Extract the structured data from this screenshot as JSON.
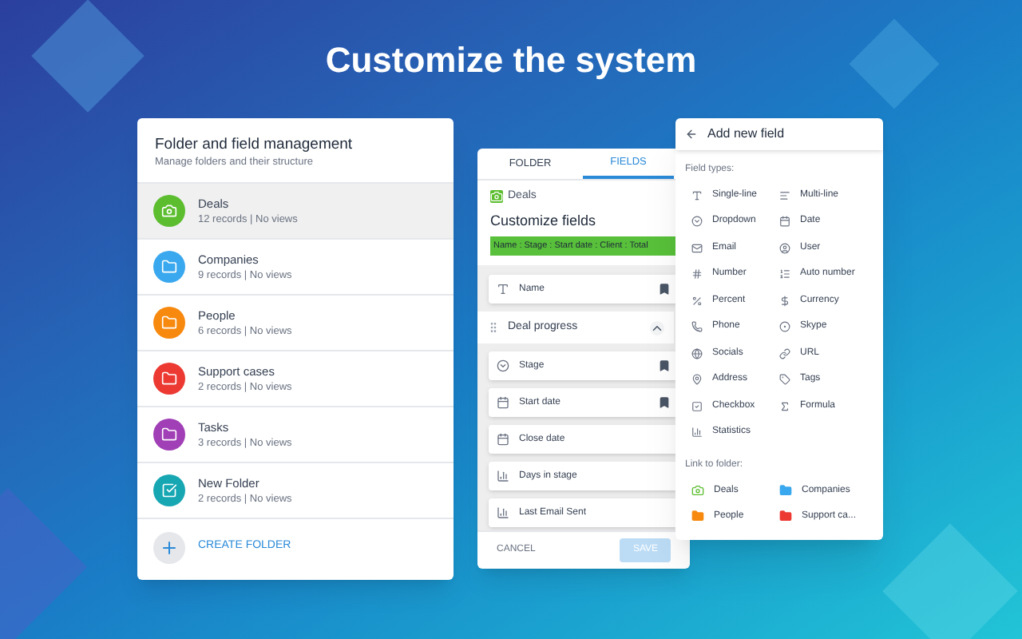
{
  "headline": "Customize the system",
  "folders_panel": {
    "title": "Folder and field management",
    "subtitle": "Manage folders and their structure",
    "folders": [
      {
        "name": "Deals",
        "info": "12 records | No views",
        "color": "#5cbd2f",
        "selected": true
      },
      {
        "name": "Companies",
        "info": "9 records | No views",
        "color": "#3aa8ee",
        "selected": false
      },
      {
        "name": "People",
        "info": "6 records | No views",
        "color": "#f7890f",
        "selected": false
      },
      {
        "name": "Support cases",
        "info": "2 records | No views",
        "color": "#ec3a33",
        "selected": false
      },
      {
        "name": "Tasks",
        "info": "3 records | No views",
        "color": "#a03fb6",
        "selected": false
      },
      {
        "name": "New Folder",
        "info": "2 records | No views",
        "color": "#17a7b3",
        "selected": false
      }
    ],
    "create_label": "CREATE FOLDER"
  },
  "fields_panel": {
    "tabs": [
      {
        "label": "FOLDER",
        "selected": false
      },
      {
        "label": "FIELDS",
        "selected": true
      }
    ],
    "folder": "Deals",
    "heading": "Customize fields",
    "summary": "Name : Stage : Start date : Client : Total",
    "items": [
      {
        "kind": "field",
        "label": "Name",
        "bookmarked": true
      },
      {
        "kind": "group",
        "label": "Deal progress",
        "expanded": true
      },
      {
        "kind": "field",
        "label": "Stage",
        "bookmarked": true
      },
      {
        "kind": "field",
        "label": "Start date",
        "bookmarked": true
      },
      {
        "kind": "field",
        "label": "Close date",
        "bookmarked": false
      },
      {
        "kind": "field",
        "label": "Days in stage",
        "bookmarked": false
      },
      {
        "kind": "field",
        "label": "Last Email Sent",
        "bookmarked": false
      }
    ],
    "cancel": "CANCEL",
    "save": {
      "label": "SAVE",
      "disabled": true
    }
  },
  "add_field_panel": {
    "title": "Add new field",
    "types_label": "Field types:",
    "types": [
      "Single-line",
      "Multi-line",
      "Dropdown",
      "Date",
      "Email",
      "User",
      "Number",
      "Auto number",
      "Percent",
      "Currency",
      "Phone",
      "Skype",
      "Socials",
      "URL",
      "Address",
      "Tags",
      "Checkbox",
      "Formula",
      "Statistics"
    ],
    "link_label": "Link to folder:",
    "links": [
      {
        "label": "Deals",
        "color": "#5cbd2f"
      },
      {
        "label": "Companies",
        "color": "#3aa8ee"
      },
      {
        "label": "People",
        "color": "#f7890f"
      },
      {
        "label": "Support ca...",
        "color": "#ec3a33"
      }
    ]
  }
}
